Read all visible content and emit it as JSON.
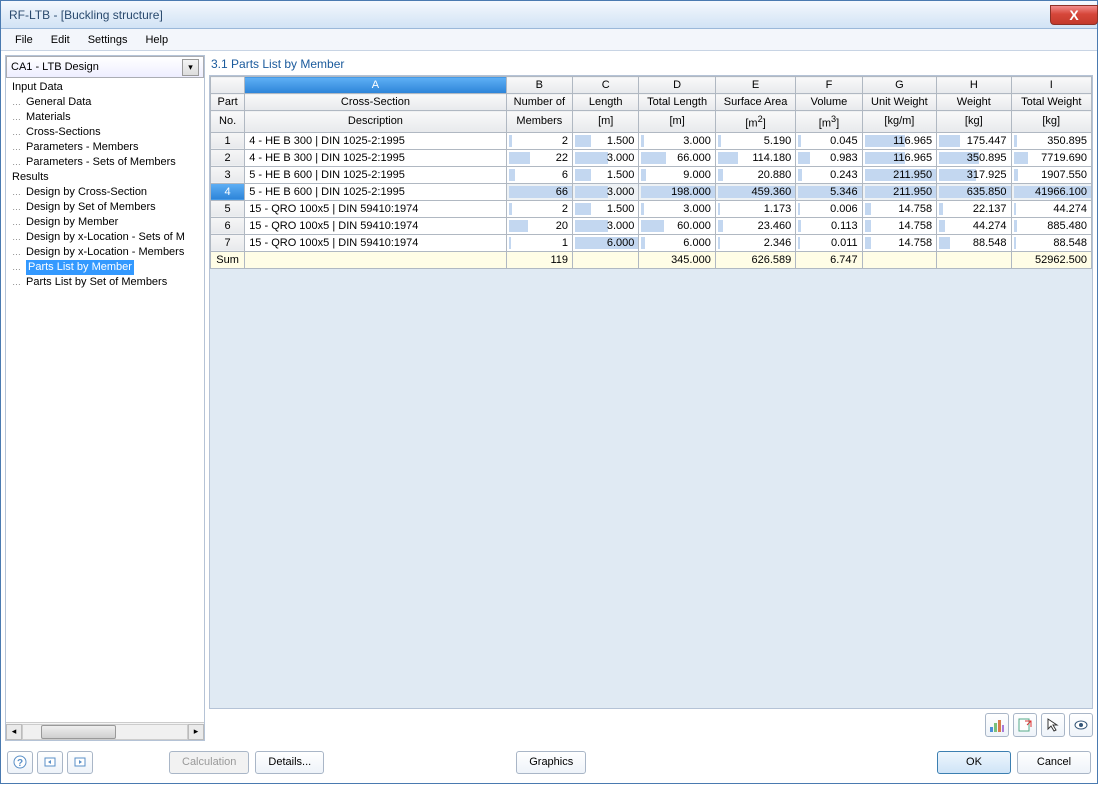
{
  "window_title": "RF-LTB - [Buckling structure]",
  "menu": [
    "File",
    "Edit",
    "Settings",
    "Help"
  ],
  "combo_selected": "CA1 - LTB Design",
  "tree": {
    "input_label": "Input Data",
    "input_children": [
      "General Data",
      "Materials",
      "Cross-Sections",
      "Parameters - Members",
      "Parameters - Sets of Members"
    ],
    "results_label": "Results",
    "results_children": [
      "Design by Cross-Section",
      "Design by Set of Members",
      "Design by Member",
      "Design by x-Location - Sets of M",
      "Design by x-Location - Members",
      "Parts List by Member",
      "Parts List by Set of Members"
    ],
    "selected": "Parts List by Member"
  },
  "pane_title": "3.1 Parts List by Member",
  "col_letters": [
    "A",
    "B",
    "C",
    "D",
    "E",
    "F",
    "G",
    "H",
    "I"
  ],
  "col_h1": [
    "Part",
    "Cross-Section",
    "Number of",
    "Length",
    "Total Length",
    "Surface Area",
    "Volume",
    "Unit Weight",
    "Weight",
    "Total Weight"
  ],
  "col_h2": [
    "No.",
    "Description",
    "Members",
    "[m]",
    "[m]",
    "[m2]",
    "[m3]",
    "[kg/m]",
    "[kg]",
    "[kg]"
  ],
  "rows": [
    {
      "no": "1",
      "desc": "4 - HE B 300 | DIN 1025-2:1995",
      "members": "2",
      "len": "1.500",
      "tlen": "3.000",
      "surf": "5.190",
      "vol": "0.045",
      "uw": "116.965",
      "w": "175.447",
      "tw": "350.895",
      "b_mem": 5,
      "b_len": 25,
      "b_tlen": 4,
      "b_surf": 4,
      "b_vol": 4,
      "b_uw": 55,
      "b_w": 28,
      "b_tw": 4
    },
    {
      "no": "2",
      "desc": "4 - HE B 300 | DIN 1025-2:1995",
      "members": "22",
      "len": "3.000",
      "tlen": "66.000",
      "surf": "114.180",
      "vol": "0.983",
      "uw": "116.965",
      "w": "350.895",
      "tw": "7719.690",
      "b_mem": 33,
      "b_len": 50,
      "b_tlen": 33,
      "b_surf": 25,
      "b_vol": 18,
      "b_uw": 55,
      "b_w": 55,
      "b_tw": 18
    },
    {
      "no": "3",
      "desc": "5 - HE B 600 | DIN 1025-2:1995",
      "members": "6",
      "len": "1.500",
      "tlen": "9.000",
      "surf": "20.880",
      "vol": "0.243",
      "uw": "211.950",
      "w": "317.925",
      "tw": "1907.550",
      "b_mem": 10,
      "b_len": 25,
      "b_tlen": 6,
      "b_surf": 6,
      "b_vol": 6,
      "b_uw": 100,
      "b_w": 50,
      "b_tw": 6
    },
    {
      "no": "4",
      "desc": "5 - HE B 600 | DIN 1025-2:1995",
      "members": "66",
      "len": "3.000",
      "tlen": "198.000",
      "surf": "459.360",
      "vol": "5.346",
      "uw": "211.950",
      "w": "635.850",
      "tw": "41966.100",
      "b_mem": 100,
      "b_len": 50,
      "b_tlen": 100,
      "b_surf": 100,
      "b_vol": 100,
      "b_uw": 100,
      "b_w": 100,
      "b_tw": 100,
      "sel": true
    },
    {
      "no": "5",
      "desc": "15 - QRO 100x5 | DIN 59410:1974",
      "members": "2",
      "len": "1.500",
      "tlen": "3.000",
      "surf": "1.173",
      "vol": "0.006",
      "uw": "14.758",
      "w": "22.137",
      "tw": "44.274",
      "b_mem": 5,
      "b_len": 25,
      "b_tlen": 4,
      "b_surf": 3,
      "b_vol": 3,
      "b_uw": 8,
      "b_w": 5,
      "b_tw": 3
    },
    {
      "no": "6",
      "desc": "15 - QRO 100x5 | DIN 59410:1974",
      "members": "20",
      "len": "3.000",
      "tlen": "60.000",
      "surf": "23.460",
      "vol": "0.113",
      "uw": "14.758",
      "w": "44.274",
      "tw": "885.480",
      "b_mem": 30,
      "b_len": 50,
      "b_tlen": 30,
      "b_surf": 6,
      "b_vol": 4,
      "b_uw": 8,
      "b_w": 8,
      "b_tw": 4
    },
    {
      "no": "7",
      "desc": "15 - QRO 100x5 | DIN 59410:1974",
      "members": "1",
      "len": "6.000",
      "tlen": "6.000",
      "surf": "2.346",
      "vol": "0.011",
      "uw": "14.758",
      "w": "88.548",
      "tw": "88.548",
      "b_mem": 3,
      "b_len": 100,
      "b_tlen": 5,
      "b_surf": 3,
      "b_vol": 3,
      "b_uw": 8,
      "b_w": 15,
      "b_tw": 3
    }
  ],
  "sum": {
    "label": "Sum",
    "members": "119",
    "tlen": "345.000",
    "surf": "626.589",
    "vol": "6.747",
    "tw": "52962.500"
  },
  "buttons": {
    "calculation": "Calculation",
    "details": "Details...",
    "graphics": "Graphics",
    "ok": "OK",
    "cancel": "Cancel"
  }
}
